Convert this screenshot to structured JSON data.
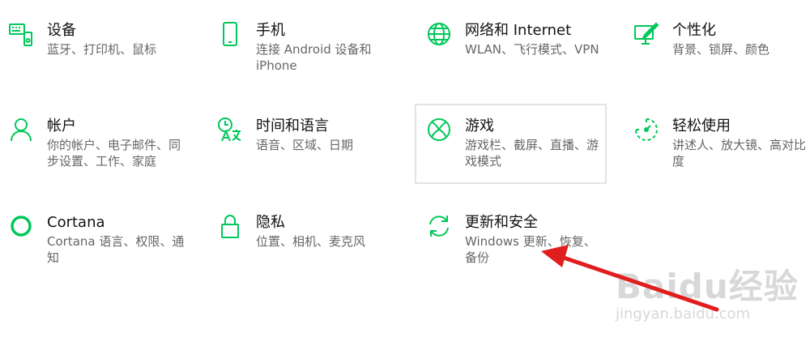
{
  "colors": {
    "accent": "#00c85a",
    "arrow": "#e01e1e"
  },
  "settings": [
    {
      "icon": "keyboard-speaker-icon",
      "title": "设备",
      "desc": "蓝牙、打印机、鼠标"
    },
    {
      "icon": "phone-icon",
      "title": "手机",
      "desc": "连接 Android 设备和 iPhone"
    },
    {
      "icon": "globe-icon",
      "title": "网络和 Internet",
      "desc": "WLAN、飞行模式、VPN"
    },
    {
      "icon": "paintbrush-icon",
      "title": "个性化",
      "desc": "背景、锁屏、颜色"
    },
    {
      "icon": "person-icon",
      "title": "帐户",
      "desc": "你的帐户、电子邮件、同步设置、工作、家庭"
    },
    {
      "icon": "time-language-icon",
      "title": "时间和语言",
      "desc": "语音、区域、日期"
    },
    {
      "icon": "xbox-icon",
      "title": "游戏",
      "desc": "游戏栏、截屏、直播、游戏模式"
    },
    {
      "icon": "ease-of-access-icon",
      "title": "轻松使用",
      "desc": "讲述人、放大镜、高对比度"
    },
    {
      "icon": "cortana-icon",
      "title": "Cortana",
      "desc": "Cortana 语言、权限、通知"
    },
    {
      "icon": "lock-icon",
      "title": "隐私",
      "desc": "位置、相机、麦克风"
    },
    {
      "icon": "update-icon",
      "title": "更新和安全",
      "desc": "Windows 更新、恢复、备份"
    }
  ],
  "watermark": {
    "logo": "Baidu经验",
    "sub": "jingyan.baidu.com"
  }
}
